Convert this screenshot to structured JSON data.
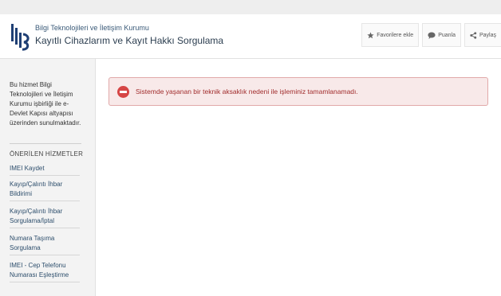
{
  "header": {
    "org_name": "Bilgi Teknolojileri ve İletişim Kurumu",
    "page_title": "Kayıtlı Cihazlarım ve Kayıt Hakkı Sorgulama",
    "actions": {
      "favorite": "Favorilere ekle",
      "rate": "Puanla",
      "share": "Paylaş"
    }
  },
  "sidebar": {
    "about": "Bu hizmet Bilgi Teknolojileri ve İletişim Kurumu işbirliği ile e-Devlet Kapısı altyapısı üzerinden sunulmaktadır.",
    "section_title": "ÖNERİLEN HİZMETLER",
    "items": [
      {
        "label": "IMEI Kaydet"
      },
      {
        "label": "Kayıp/Çalıntı İhbar Bildirimi"
      },
      {
        "label": "Kayıp/Çalıntı İhbar Sorgulama/İptal"
      },
      {
        "label": "Numara Taşıma Sorgulama"
      },
      {
        "label": "IMEI - Cep Telefonu Numarası Eşleştirme"
      }
    ]
  },
  "alert": {
    "message": "Sistemde yaşanan bir teknik aksaklık nedeni ile işleminiz tamamlanamadı."
  },
  "colors": {
    "alert_background": "#f8e9e9",
    "alert_border": "#e1a9a9",
    "alert_text": "#a12d2d",
    "alert_icon": "#d64545",
    "link_text": "#2d4e6c"
  }
}
